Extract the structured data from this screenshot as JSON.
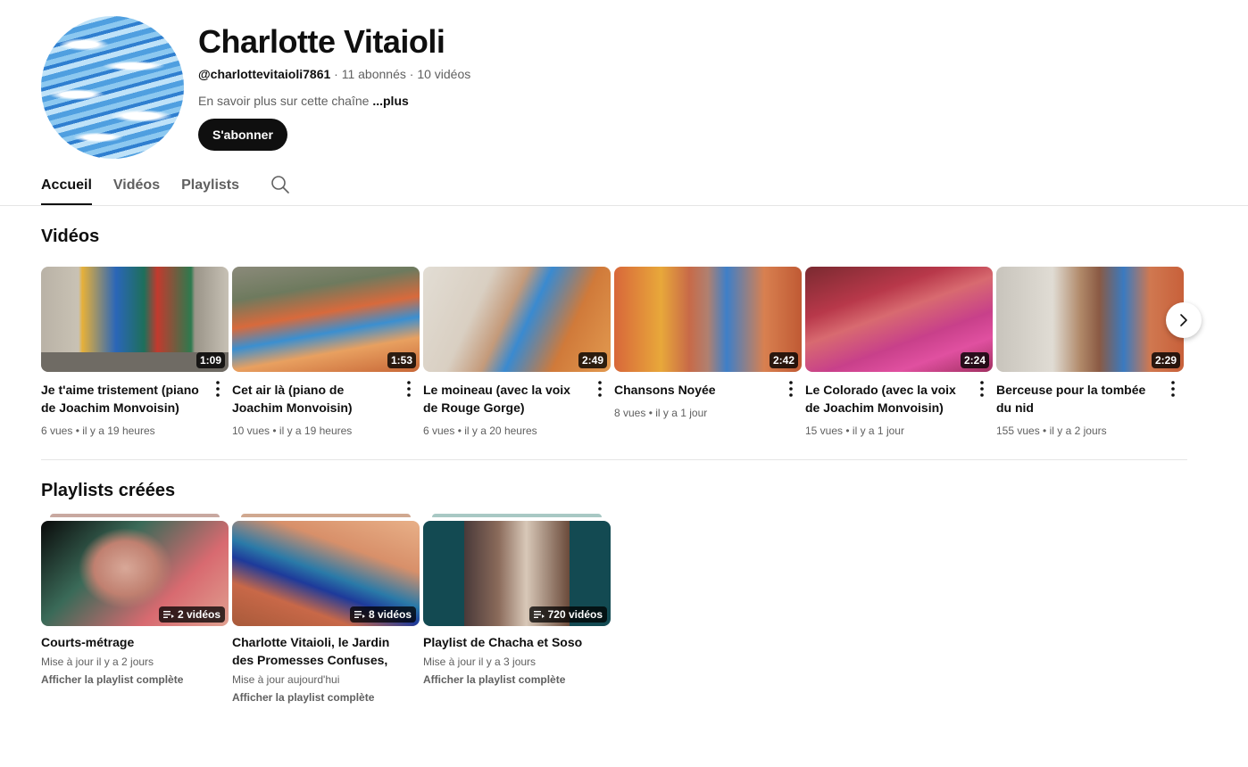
{
  "channel": {
    "name": "Charlotte Vitaioli",
    "handle": "@charlottevitaioli7861",
    "subscribers": "11 abonnés",
    "video_count": "10 vidéos",
    "separator": "·",
    "description": "En savoir plus sur cette chaîne",
    "more_label": "...plus",
    "subscribe_label": "S'abonner"
  },
  "tabs": [
    {
      "label": "Accueil",
      "active": true
    },
    {
      "label": "Vidéos",
      "active": false
    },
    {
      "label": "Playlists",
      "active": false
    }
  ],
  "videos_section": {
    "title": "Vidéos",
    "items": [
      {
        "title": "Je t'aime tristement (piano de Joachim Monvoisin)",
        "duration": "1:09",
        "views": "6 vues",
        "age": "il y a 19 heures"
      },
      {
        "title": "Cet air là (piano de Joachim Monvoisin)",
        "duration": "1:53",
        "views": "10 vues",
        "age": "il y a 19 heures"
      },
      {
        "title": "Le moineau (avec la voix de Rouge Gorge)",
        "duration": "2:49",
        "views": "6 vues",
        "age": "il y a 20 heures"
      },
      {
        "title": "Chansons Noyée",
        "duration": "2:42",
        "views": "8 vues",
        "age": "il y a 1 jour"
      },
      {
        "title": "Le Colorado (avec la voix de Joachim Monvoisin)",
        "duration": "2:24",
        "views": "15 vues",
        "age": "il y a 1 jour"
      },
      {
        "title": "Berceuse pour la tombée du nid",
        "duration": "2:29",
        "views": "155 vues",
        "age": "il y a 2 jours"
      }
    ],
    "meta_separator": "•"
  },
  "playlists_section": {
    "title": "Playlists créées",
    "items": [
      {
        "title": "Courts-métrage",
        "count": "2 vidéos",
        "updated": "Mise à jour il y a 2 jours",
        "link": "Afficher la playlist complète"
      },
      {
        "title": "Charlotte Vitaioli, le Jardin des Promesses Confuses,",
        "count": "8 vidéos",
        "updated": "Mise à jour aujourd'hui",
        "link": "Afficher la playlist complète"
      },
      {
        "title": "Playlist de Chacha et Soso",
        "count": "720 vidéos",
        "updated": "Mise à jour il y a 3 jours",
        "link": "Afficher la playlist complète"
      }
    ]
  },
  "icons": {
    "search": "search-icon",
    "next": "chevron-right-icon",
    "more": "more-vert-icon",
    "playlist": "playlist-icon"
  }
}
